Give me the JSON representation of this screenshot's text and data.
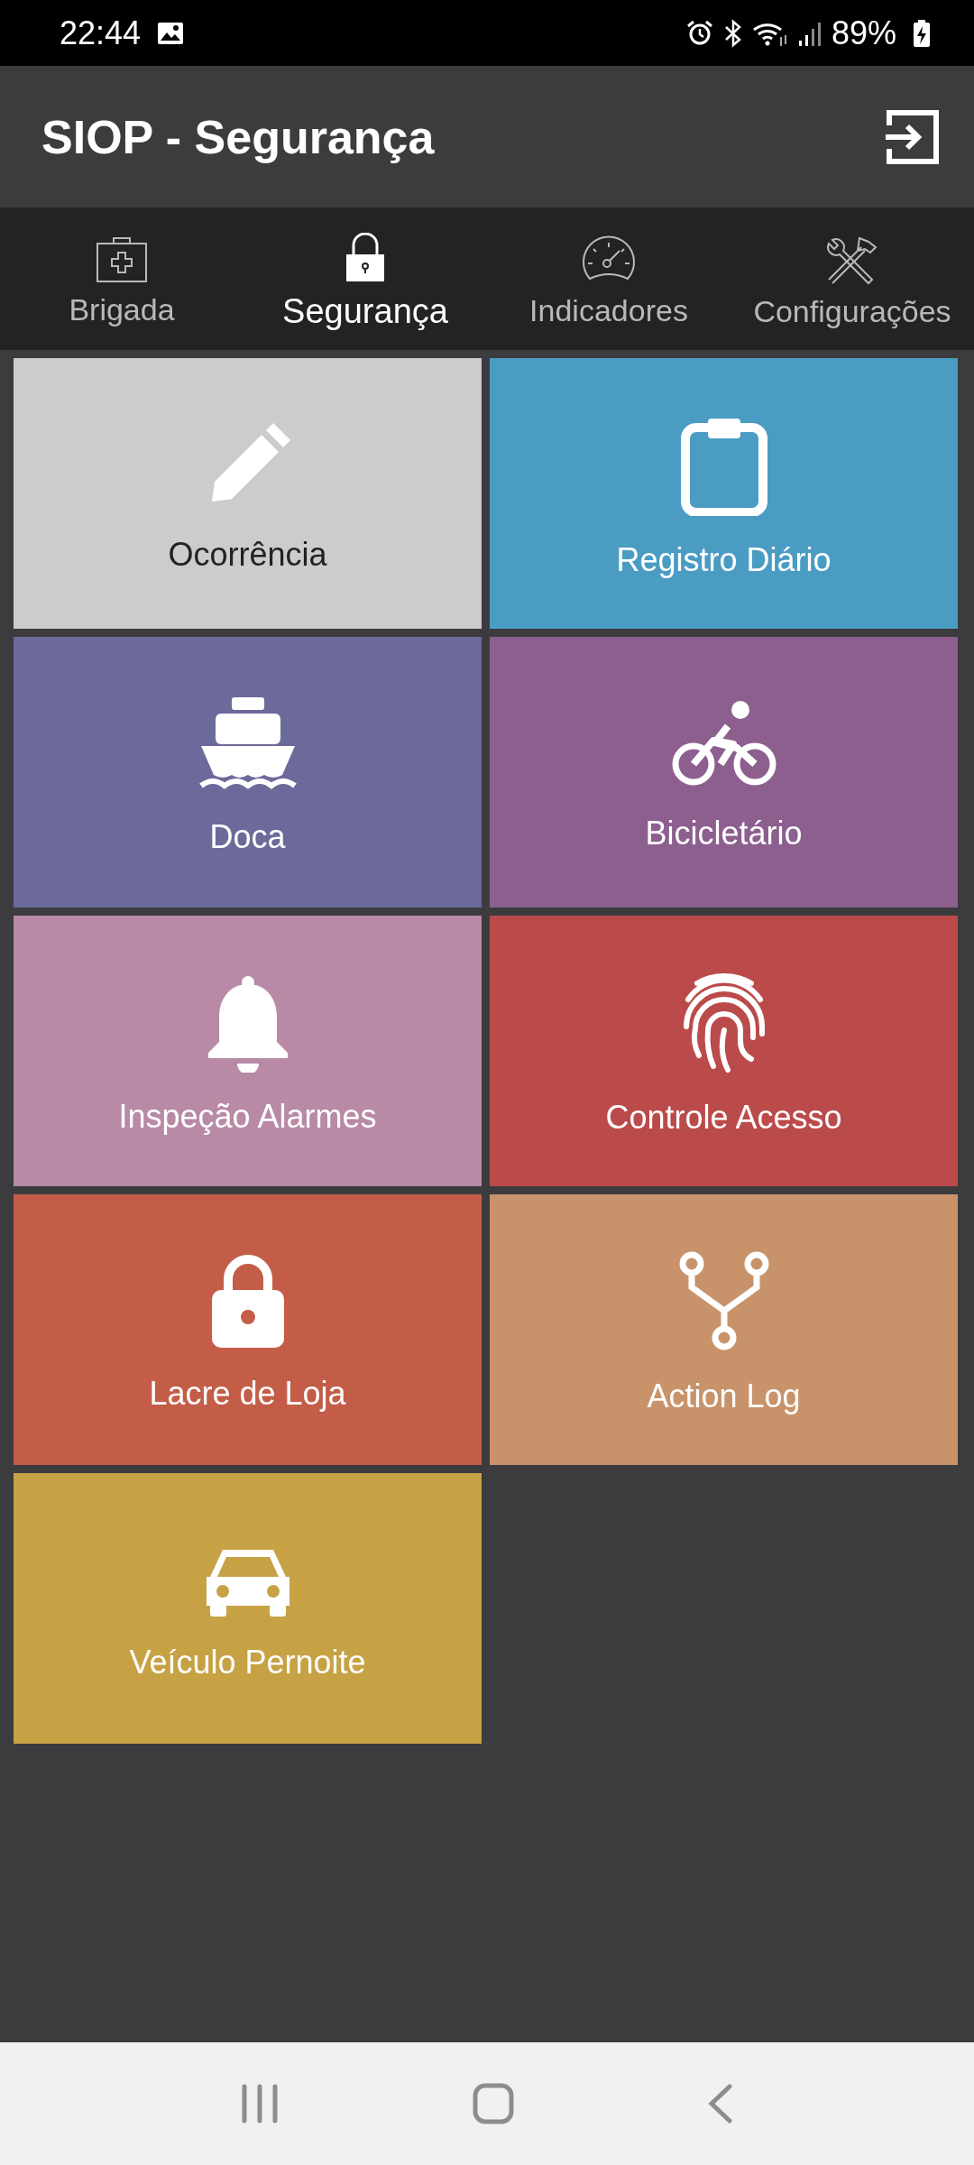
{
  "status_bar": {
    "time": "22:44",
    "battery": "89%"
  },
  "app_bar": {
    "title": "SIOP - Segurança"
  },
  "tabs": [
    {
      "label": "Brigada",
      "kind": "medkit",
      "selected": false
    },
    {
      "label": "Segurança",
      "kind": "lock",
      "selected": true
    },
    {
      "label": "Indicadores",
      "kind": "gauge",
      "selected": false
    },
    {
      "label": "Configurações",
      "kind": "tools",
      "selected": false
    }
  ],
  "tiles": [
    {
      "label": "Ocorrência",
      "kind": "pencil",
      "color": "#cdcbce"
    },
    {
      "label": "Registro Diário",
      "kind": "clipboard",
      "color": "#4a9cc3"
    },
    {
      "label": "Doca",
      "kind": "ship",
      "color": "#6c6a9a"
    },
    {
      "label": "Bicicletário",
      "kind": "bicycle",
      "color": "#8c5f8f"
    },
    {
      "label": "Inspeção Alarmes",
      "kind": "bell",
      "color": "#b88aa6"
    },
    {
      "label": "Controle Acesso",
      "kind": "fingerprint",
      "color": "#bb4b4a"
    },
    {
      "label": "Lacre de Loja",
      "kind": "lock",
      "color": "#c35d48"
    },
    {
      "label": "Action Log",
      "kind": "fork",
      "color": "#c8936a"
    },
    {
      "label": "Veículo Pernoite",
      "kind": "car",
      "color": "#c6a244"
    }
  ]
}
